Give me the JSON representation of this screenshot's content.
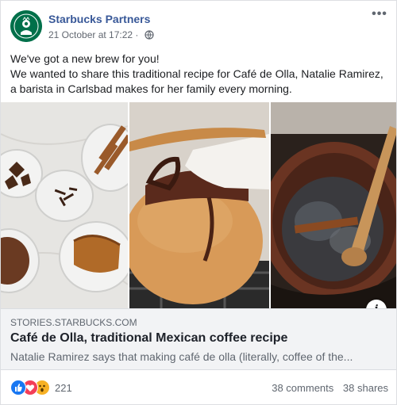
{
  "post": {
    "page_name": "Starbucks Partners",
    "timestamp": "21 October at 17:22",
    "separator": "·",
    "privacy_icon": "globe-icon",
    "more_icon": "more-options-icon",
    "text_lines": [
      "We've got a new brew for you!",
      "We wanted to share this traditional recipe for Café de Olla, Natalie Ramirez, a barista in Carlsbad makes for her family every morning."
    ]
  },
  "gallery": {
    "panels": [
      "spices-bowls-photo",
      "clay-pot-photo",
      "brewing-pot-photo"
    ],
    "info_icon": "i"
  },
  "link": {
    "domain": "STORIES.STARBUCKS.COM",
    "title": "Café de Olla, traditional Mexican coffee recipe",
    "description": "Natalie Ramirez says that making café de olla (literally, coffee of the..."
  },
  "footer": {
    "reaction_count": "221",
    "reactions": [
      "like-icon",
      "love-icon",
      "wow-icon"
    ],
    "comments": "38 comments",
    "shares": "38 shares"
  },
  "colors": {
    "brand_green": "#00704a",
    "link_blue": "#385898",
    "like_blue": "#1877f2",
    "love_red": "#f33e58",
    "wow_yellow": "#f7b125"
  }
}
